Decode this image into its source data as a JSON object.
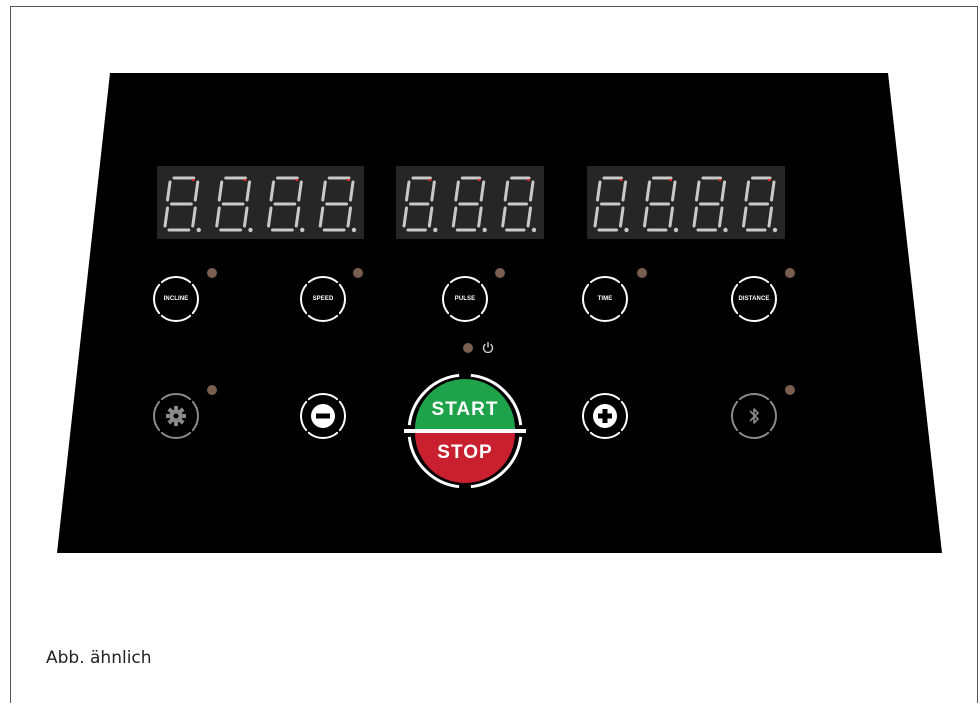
{
  "displays": [
    {
      "name": "display-left",
      "digits": 4
    },
    {
      "name": "display-center",
      "digits": 3
    },
    {
      "name": "display-right",
      "digits": 4
    }
  ],
  "mode_buttons": [
    {
      "key": "incline",
      "label": "INCLINE"
    },
    {
      "key": "speed",
      "label": "SPEED"
    },
    {
      "key": "pulse",
      "label": "PULSE"
    },
    {
      "key": "time",
      "label": "TIME"
    },
    {
      "key": "distance",
      "label": "DISTANCE"
    }
  ],
  "control_buttons": {
    "settings": {
      "icon": "gear-icon"
    },
    "minus": {
      "icon": "minus-icon"
    },
    "plus": {
      "icon": "plus-icon"
    },
    "bluetooth": {
      "icon": "bluetooth-icon"
    }
  },
  "start_stop": {
    "start_label": "START",
    "stop_label": "STOP",
    "start_color": "#1fa34a",
    "stop_color": "#c8202e"
  },
  "power_indicator": {
    "icon": "power-icon"
  },
  "colors": {
    "panel": "#000000",
    "display_bg": "#262626",
    "segment_off": "#c9c9c9",
    "segment_tick": "#d83030",
    "indicator_led": "#7a5e50"
  },
  "caption": "Abb. ähnlich"
}
